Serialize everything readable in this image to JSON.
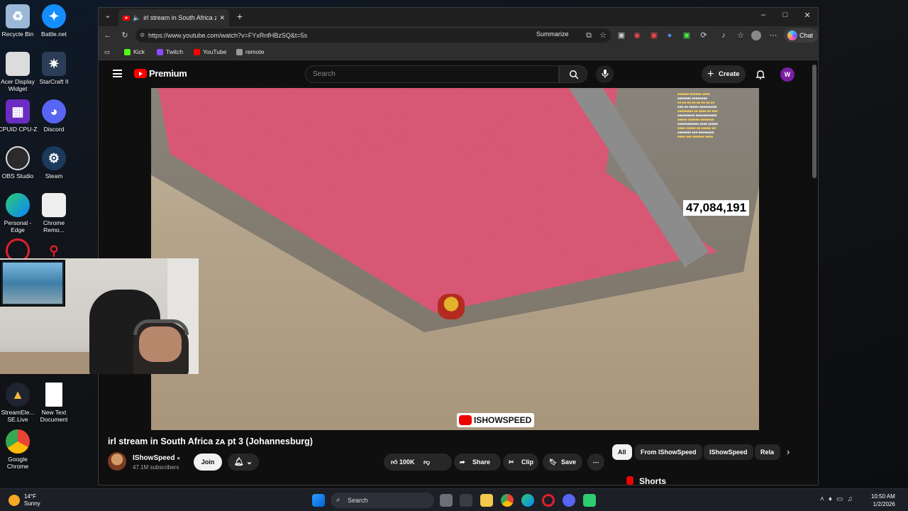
{
  "desktop_icons": [
    {
      "label": "Recycle Bin",
      "icon": "recycle-bin-icon"
    },
    {
      "label": "Battle.net",
      "icon": "battlenet-icon"
    },
    {
      "label": "Acer Display Widget",
      "icon": "acer-icon"
    },
    {
      "label": "StarCraft II",
      "icon": "starcraft-icon"
    },
    {
      "label": "CPUID CPU-Z",
      "icon": "cpuz-icon"
    },
    {
      "label": "Discord",
      "icon": "discord-icon"
    },
    {
      "label": "OBS Studio",
      "icon": "obs-icon"
    },
    {
      "label": "Steam",
      "icon": "steam-icon"
    },
    {
      "label": "Personal - Edge",
      "icon": "edge-icon"
    },
    {
      "label": "Chrome Remo...",
      "icon": "chrome-remote-icon"
    },
    {
      "label": "StreamEle... SE.Live",
      "icon": "streamelements-icon"
    },
    {
      "label": "New Text Document",
      "icon": "text-document-icon"
    },
    {
      "label": "Google Chrome",
      "icon": "chrome-icon"
    }
  ],
  "browser": {
    "tab_title": "irl stream in South Africa ᴢᴀ pt",
    "url": "https://www.youtube.com/watch?v=FYxRnfHBzSQ&t=5s",
    "summarize_label": "Summarize",
    "chat_label": "Chat",
    "bookmarks": [
      {
        "label": "Kick",
        "color": "#53fc18"
      },
      {
        "label": "Twitch",
        "color": "#9146ff"
      },
      {
        "label": "YouTube",
        "color": "#ff0000"
      },
      {
        "label": "remote",
        "color": "#999999"
      }
    ]
  },
  "youtube": {
    "logo_text": "Premium",
    "search_placeholder": "Search",
    "create_label": "Create",
    "avatar_letter": "W",
    "video": {
      "counter": "47,084,191",
      "watermark": "ISHOWSPEED",
      "title": "irl stream in South Africa ᴢᴀ pt 3 (Johannesburg)",
      "channel": "IShowSpeed",
      "subscribers": "47.1M subscribers",
      "join_label": "Join",
      "likes": "100K",
      "share_label": "Share",
      "clip_label": "Clip",
      "save_label": "Save"
    },
    "chips": [
      "All",
      "From IShowSpeed",
      "IShowSpeed",
      "Rela"
    ],
    "shorts_label": "Shorts"
  },
  "taskbar": {
    "temperature": "14°F",
    "condition": "Sunny",
    "search_label": "Search",
    "time": "10:50 AM",
    "date": "1/2/2026"
  }
}
